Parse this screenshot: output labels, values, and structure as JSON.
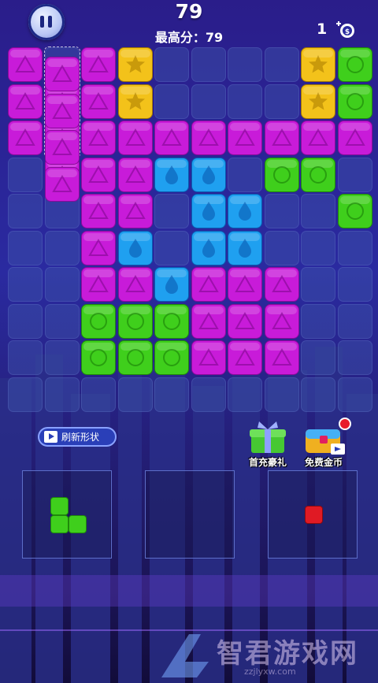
{
  "hud": {
    "score": "79",
    "best_label": "最高分：79",
    "coins": "1"
  },
  "board": {
    "cols": 10,
    "rows": 10,
    "grid": [
      "P.PYSSSSYG",
      "PPPY....YG",
      "PPPPPPPPPP",
      ".PPPBB.GG.",
      "..PP.BB..G",
      "..PB.BB...",
      "..PPBPPP..",
      "..GGGPPP..",
      "..GGGPPP..",
      ".........."
    ],
    "legend": {
      "P": "triangle-purple",
      "Y": "star-yellow",
      "G": "circle-green",
      "B": "drop-blue",
      "S": "empty",
      ".": "empty"
    },
    "floating_piece": {
      "shape": "triangle-purple",
      "cells": [
        [
          1,
          0
        ],
        [
          1,
          1
        ],
        [
          1,
          2
        ],
        [
          1,
          3
        ],
        [
          1,
          4
        ]
      ]
    }
  },
  "colors": {
    "purple": "#c81bd9",
    "yellow": "#f3c21a",
    "green": "#3fcf1c",
    "blue": "#1fa0f0",
    "red": "#e01a24"
  },
  "refresh_button": {
    "label": "刷新形状"
  },
  "promos": {
    "gift_label": "首充豪礼",
    "coins_label": "免费金币"
  },
  "trays": [
    {
      "piece": "green-L",
      "cells": [
        [
          0,
          0
        ],
        [
          0,
          1
        ],
        [
          1,
          1
        ]
      ]
    },
    {
      "piece": "empty",
      "cells": []
    },
    {
      "piece": "red-single",
      "cells": [
        [
          0,
          0
        ]
      ]
    }
  ],
  "watermark": {
    "text": "智君游戏网",
    "url": "zzjlyxw.com"
  }
}
